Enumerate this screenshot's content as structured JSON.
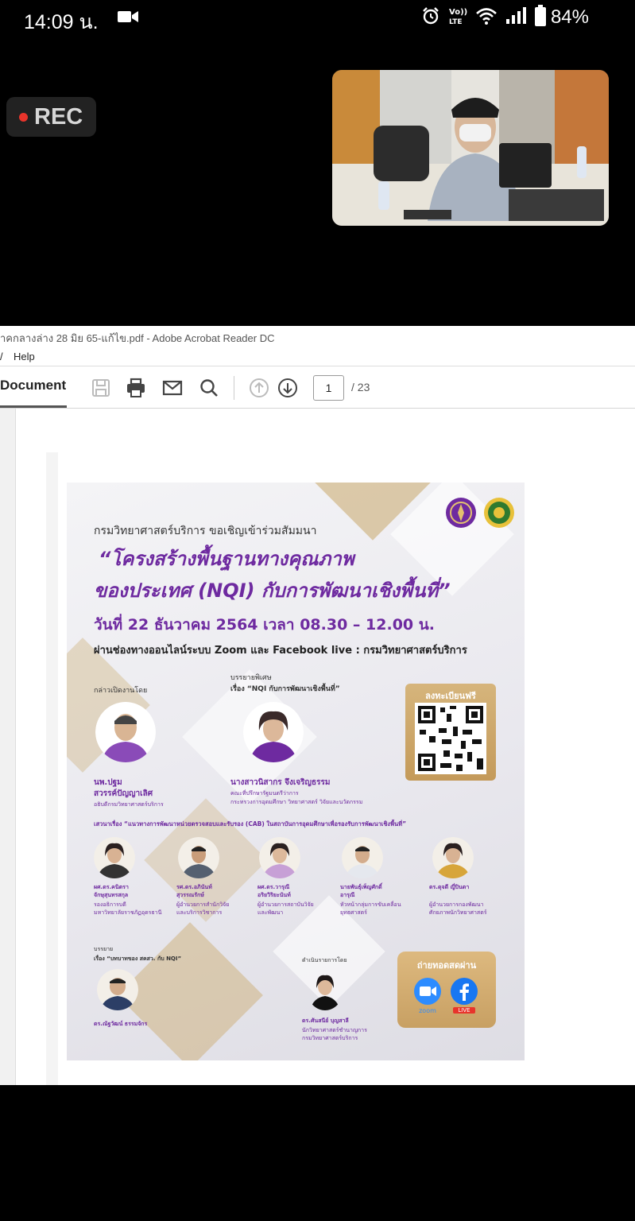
{
  "status_bar": {
    "time": "14:09 น.",
    "battery": "84%",
    "icons": [
      "video-camera-icon",
      "alarm-icon",
      "volte-icon",
      "wifi-icon",
      "signal-icon",
      "battery-icon"
    ]
  },
  "meeting": {
    "rec_label": "REC"
  },
  "acrobat": {
    "window_title": "าคกลางล่าง 28 มิย 65-แก้ไข.pdf - Adobe Acrobat Reader DC",
    "menu": [
      "/",
      "Help"
    ],
    "document_tab": "Document",
    "page_current": "1",
    "page_total": "/ 23"
  },
  "poster": {
    "intro": "กรมวิทยาศาสตร์บริการ ขอเชิญเข้าร่วมสัมมนา",
    "title_line1": "“โครงสร้างพื้นฐานทางคุณภาพ",
    "title_line2": "ของประเทศ (NQI) กับการพัฒนาเชิงพื้นที่”",
    "date": "วันที่ 22 ธันวาคม 2564 เวลา 08.30 – 12.00 น.",
    "channel": "ผ่านช่องทางออนไลน์ระบบ Zoom และ Facebook live : กรมวิทยาศาสตร์บริการ",
    "opening_label": "กล่าวเปิดงานโดย",
    "opening_name1": "นพ.ปฐม",
    "opening_name2": "สวรรค์ปัญญาเลิศ",
    "opening_role": "อธิบดีกรมวิทยาศาสตร์บริการ",
    "keynote_label": "บรรยายพิเศษ",
    "keynote_topic": "เรื่อง “NQI กับการพัฒนาเชิงพื้นที่”",
    "keynote_name": "นางสาวนิสากร จึงเจริญธรรม",
    "keynote_role1": "คณะที่ปรึกษารัฐมนตรีว่าการ",
    "keynote_role2": "กระทรวงการอุดมศึกษา วิทยาศาสตร์ วิจัยและนวัตกรรม",
    "register_label": "ลงทะเบียนฟรี",
    "panel_topic": "เสวนาเรื่อง “แนวทางการพัฒนาหน่วยตรวจสอบและรับรอง (CAB) ในสถาบันการอุดมศึกษาเพื่อรองรับการพัฒนาเชิงพื้นที่”",
    "panelists": [
      {
        "name": "ผศ.ดร.คนิตรา",
        "name2": "จักษุสุนทรสกุล",
        "role": "รองอธิการบดี",
        "role2": "มหาวิทยาลัยราชภัฏอุดรธานี"
      },
      {
        "name": "รศ.ดร.อภินันท์",
        "name2": "สุวรรณรักษ์",
        "role": "ผู้อำนวยการสำนักวิจัย",
        "role2": "และบริการวิชาการ"
      },
      {
        "name": "ผศ.ดร.วารุณี",
        "name2": "อริยวิริยะนันท์",
        "role": "ผู้อำนวยการสถาบันวิจัย",
        "role2": "และพัฒนา"
      },
      {
        "name": "นายพันธุ์เพ็ญศักดิ์",
        "name2": "อารุณี",
        "role": "หัวหน้ากลุ่มการขับเคลื่อน",
        "role2": "ยุทธศาสตร์"
      },
      {
        "name": "ดร.ดุจดี ญี่ปินตา",
        "name2": "",
        "role": "ผู้อำนวยการกองพัฒนา",
        "role2": "ศักยภาพนักวิทยาศาสตร์"
      }
    ],
    "talk_label": "บรรยาย",
    "talk_topic": "เรื่อง “บทบาทของ สคสว. กับ NQI”",
    "talk_name": "ดร.ณัฐวัฒน์ ธรรมจักร",
    "host_label": "ดำเนินรายการโดย",
    "host_name": "ดร.ศันสนีย์ บุญสาลี",
    "host_role": "นักวิทยาศาสตร์ชำนาญการ",
    "host_role2": "กรมวิทยาศาสตร์บริการ",
    "live_label": "ถ่ายทอดสดผ่าน",
    "zoom_label": "zoom",
    "fb_label": "LIVE"
  },
  "colors": {
    "accent_purple": "#6e2aa0",
    "gold": "#c8a063",
    "rec_red": "#e8342b"
  }
}
